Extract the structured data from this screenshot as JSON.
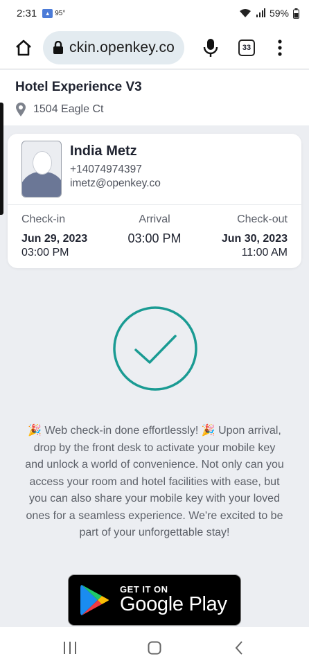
{
  "status_bar": {
    "time": "2:31",
    "temperature": "95°",
    "battery": "59%"
  },
  "browser": {
    "url": "ckin.openkey.co",
    "tabs_count": "33"
  },
  "hotel": {
    "name": "Hotel Experience V3",
    "address": "1504 Eagle Ct"
  },
  "guest": {
    "name": "India Metz",
    "phone": "+14074974397",
    "email": "imetz@openkey.co"
  },
  "stay": {
    "checkin_label": "Check-in",
    "checkin_date": "Jun 29, 2023",
    "checkin_time": "03:00 PM",
    "arrival_label": "Arrival",
    "arrival_time": "03:00 PM",
    "checkout_label": "Check-out",
    "checkout_date": "Jun 30, 2023",
    "checkout_time": "11:00 AM"
  },
  "message": "🎉 Web check-in done effortlessly! 🎉 Upon arrival, drop by the front desk to activate your mobile key and unlock a world of convenience. Not only can you access your room and hotel facilities with ease, but you can also share your mobile key with your loved ones for a seamless experience. We're excited to be part of your unforgettable stay!",
  "google_play": {
    "small": "GET IT ON",
    "big": "Google Play"
  },
  "colors": {
    "accent": "#1a9b93",
    "background": "#eceef2"
  },
  "icons": [
    "home-icon",
    "lock-icon",
    "mic-icon",
    "tabs-icon",
    "more-vert-icon",
    "location-pin-icon",
    "checkmark-icon",
    "google-play-icon",
    "recents-icon",
    "home-nav-icon",
    "back-icon"
  ]
}
